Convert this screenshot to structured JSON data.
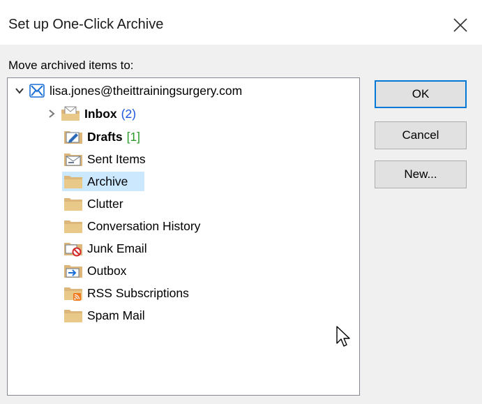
{
  "dialog": {
    "title": "Set up One-Click Archive",
    "move_label": "Move archived items to:"
  },
  "tree": {
    "account": "lisa.jones@theittrainingsurgery.com",
    "folders": [
      {
        "label": "Inbox",
        "count": "(2)",
        "bold": true,
        "icon": "inbox-folder-icon",
        "expandable": true
      },
      {
        "label": "Drafts",
        "count": "[1]",
        "bold": true,
        "icon": "drafts-folder-icon"
      },
      {
        "label": "Sent Items",
        "icon": "sent-items-folder-icon"
      },
      {
        "label": "Archive",
        "icon": "folder-icon",
        "selected": true
      },
      {
        "label": "Clutter",
        "icon": "folder-icon"
      },
      {
        "label": "Conversation History",
        "icon": "folder-icon"
      },
      {
        "label": "Junk Email",
        "icon": "junk-email-folder-icon"
      },
      {
        "label": "Outbox",
        "icon": "outbox-folder-icon"
      },
      {
        "label": "RSS Subscriptions",
        "icon": "rss-folder-icon"
      },
      {
        "label": "Spam Mail",
        "icon": "folder-icon"
      }
    ]
  },
  "buttons": {
    "ok": "OK",
    "cancel": "Cancel",
    "new": "New..."
  },
  "colors": {
    "selection": "#cce8ff",
    "accent": "#0078d7",
    "folder": "#dcb67a",
    "inbox_count": "#1a55e0",
    "drafts_count": "#2a9a2a"
  }
}
